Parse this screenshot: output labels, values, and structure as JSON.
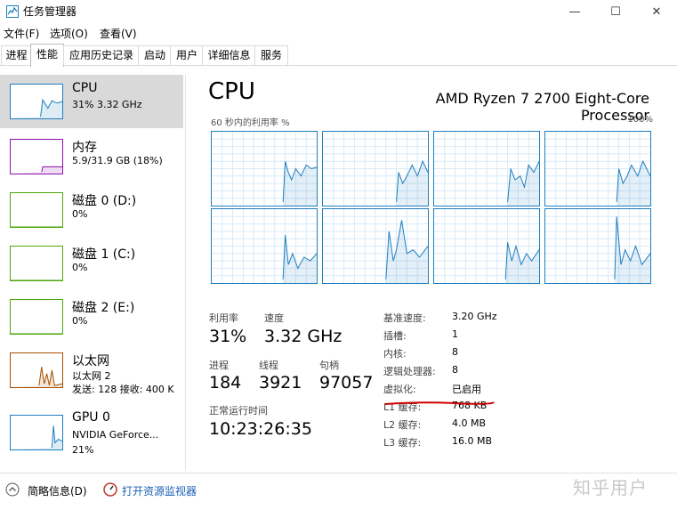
{
  "window": {
    "title": "任务管理器",
    "controls": [
      "—",
      "☐",
      "✕"
    ]
  },
  "menu": {
    "items": [
      "文件(F)",
      "选项(O)",
      "查看(V)"
    ]
  },
  "tabs": [
    "进程",
    "性能",
    "应用历史记录",
    "启动",
    "用户",
    "详细信息",
    "服务"
  ],
  "active_tab": "性能",
  "sidebar": {
    "items": [
      {
        "name": "CPU",
        "sub1": "31% 3.32 GHz",
        "sub2": "",
        "color": "#1e7fbf",
        "level": 0.31
      },
      {
        "name": "内存",
        "sub1": "5.9/31.9 GB (18%)",
        "sub2": "",
        "color": "#8b12ae",
        "level": 0.18
      },
      {
        "name": "磁盘 0 (D:)",
        "sub1": "0%",
        "sub2": "",
        "color": "#4da60c",
        "level": 0.0
      },
      {
        "name": "磁盘 1 (C:)",
        "sub1": "0%",
        "sub2": "",
        "color": "#4da60c",
        "level": 0.0
      },
      {
        "name": "磁盘 2 (E:)",
        "sub1": "0%",
        "sub2": "",
        "color": "#4da60c",
        "level": 0.0
      },
      {
        "name": "以太网",
        "sub1": "以太网 2",
        "sub2": "发送: 128 接收: 400 K",
        "color": "#a74f01",
        "level": 0.5
      },
      {
        "name": "GPU 0",
        "sub1": "NVIDIA GeForce...",
        "sub2": "21%",
        "color": "#1e7fbf",
        "level": 0.21
      }
    ]
  },
  "main": {
    "title": "CPU",
    "model": "AMD Ryzen 7 2700 Eight-Core Processor",
    "graph_caption_left": "60 秒内的利用率 %",
    "graph_caption_right": "100%",
    "stats": {
      "utilization_label": "利用率",
      "utilization": "31%",
      "speed_label": "速度",
      "speed": "3.32 GHz",
      "processes_label": "进程",
      "processes": "184",
      "threads_label": "线程",
      "threads": "3921",
      "handles_label": "句柄",
      "handles": "97057",
      "uptime_label": "正常运行时间",
      "uptime": "10:23:26:35"
    },
    "specs": [
      {
        "label": "基准速度:",
        "value": "3.20 GHz"
      },
      {
        "label": "插槽:",
        "value": "1"
      },
      {
        "label": "内核:",
        "value": "8"
      },
      {
        "label": "逻辑处理器:",
        "value": "8"
      },
      {
        "label": "虚拟化:",
        "value": "已启用"
      },
      {
        "label": "L1 缓存:",
        "value": "768 KB"
      },
      {
        "label": "L2 缓存:",
        "value": "4.0 MB"
      },
      {
        "label": "L3 缓存:",
        "value": "16.0 MB"
      }
    ],
    "accent_color": "#1e7fbf",
    "highlight_color": "#cc0000"
  },
  "footer": {
    "summary": "简略信息(D)",
    "monitor": "打开资源监视器"
  },
  "watermark": "知乎用户"
}
